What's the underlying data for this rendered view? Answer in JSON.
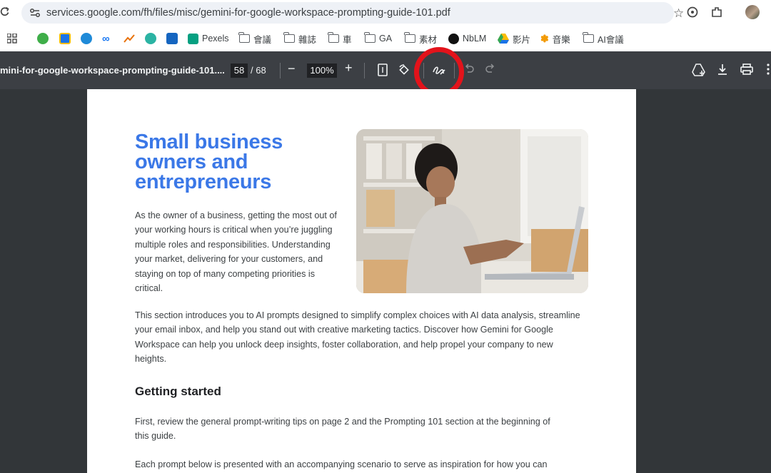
{
  "browser": {
    "url": "services.google.com/fh/files/misc/gemini-for-google-workspace-prompting-guide-101.pdf",
    "bookmarks": [
      {
        "label": "Pexels",
        "icon": "pexels-icon"
      },
      {
        "label": "會議",
        "icon": "folder-icon"
      },
      {
        "label": "雜誌",
        "icon": "folder-icon"
      },
      {
        "label": "車",
        "icon": "folder-icon"
      },
      {
        "label": "GA",
        "icon": "folder-icon"
      },
      {
        "label": "素材",
        "icon": "folder-icon"
      },
      {
        "label": "NbLM",
        "icon": "notebooklm-icon"
      },
      {
        "label": "影片",
        "icon": "google-drive-icon"
      },
      {
        "label": "音樂",
        "icon": "music-icon"
      },
      {
        "label": "AI會議",
        "icon": "folder-icon"
      }
    ]
  },
  "pdf_toolbar": {
    "title": "mini-for-google-workspace-prompting-guide-101....",
    "current_page": "58",
    "total_pages": "/ 68",
    "zoom": "100%",
    "minus": "−",
    "plus": "+",
    "highlighted_tool": "draw-annotation-icon",
    "highlight_color": "#e3131b"
  },
  "document": {
    "heading": "Small business owners and entrepreneurs",
    "heading_color": "#3b78e7",
    "intro": "As the owner of a business, getting the most out of your working hours is critical when you’re juggling multiple roles and responsibilities. Understanding your market, delivering for your customers, and staying on top of many competing priorities is critical.",
    "section_text": "This section introduces you to AI prompts designed to simplify complex choices with AI data analysis, streamline your email inbox, and help you stand out with creative marketing tactics. Discover how Gemini for Google Workspace can help you unlock deep insights, foster collaboration, and help propel your company to new heights.",
    "subheading": "Getting started",
    "getting_started_text": "First, review the general prompt-writing tips on page 2 and the Prompting 101 section at the beginning of this guide.",
    "last_text": "Each prompt below is presented with an accompanying scenario to serve as inspiration for how you can"
  }
}
